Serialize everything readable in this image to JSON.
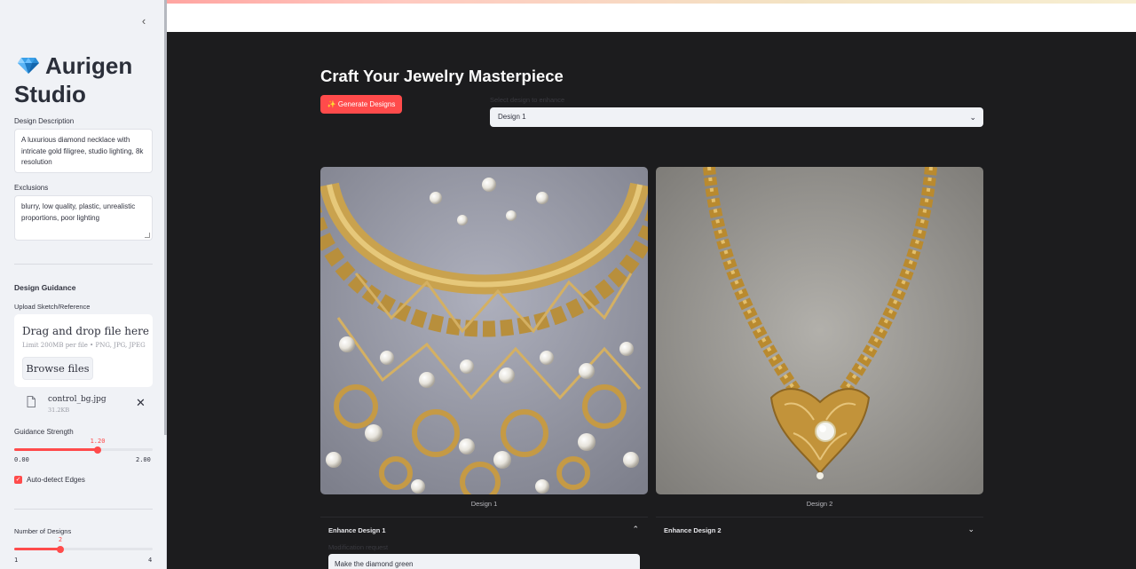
{
  "sidebar": {
    "collapse_icon": "chevron-left-icon",
    "app_icon": "gem-icon",
    "app_title": "Aurigen Studio",
    "design_description_label": "Design Description",
    "design_description_value": "A luxurious diamond necklace with intricate gold filigree, studio lighting, 8k resolution",
    "exclusions_label": "Exclusions",
    "exclusions_value": "blurry, low quality, plastic, unrealistic proportions, poor lighting",
    "design_guidance_heading": "Design Guidance",
    "upload_label": "Upload Sketch/Reference",
    "dropzone_title": "Drag and drop file here",
    "dropzone_subtitle": "Limit 200MB per file • PNG, JPG, JPEG",
    "browse_label": "Browse files",
    "uploaded_file": {
      "name": "control_bg.jpg",
      "size": "31.2KB",
      "icon": "file-icon"
    },
    "guidance_strength": {
      "label": "Guidance Strength",
      "value_text": "1.20",
      "value": 1.2,
      "min_text": "0.00",
      "max_text": "2.00"
    },
    "auto_detect_edges": {
      "label": "Auto-detect Edges",
      "checked": true
    },
    "num_designs": {
      "label": "Number of Designs",
      "value_text": "2",
      "value": 2,
      "min_text": "1",
      "max_text": "4"
    }
  },
  "main": {
    "title": "Craft Your Jewelry Masterpiece",
    "generate_button": "✨ Generate Designs",
    "select_label": "Select design to enhance",
    "select_value": "Design 1",
    "designs": [
      {
        "caption": "Design 1",
        "expander_label": "Enhance Design 1",
        "expanded": true
      },
      {
        "caption": "Design 2",
        "expander_label": "Enhance Design 2",
        "expanded": false
      }
    ],
    "modification_label": "Modification request",
    "modification_value": "Make the diamond green"
  },
  "colors": {
    "accent": "#ff4b4b",
    "sidebar_bg": "#f0f2f6",
    "main_bg": "#1c1c1e"
  }
}
